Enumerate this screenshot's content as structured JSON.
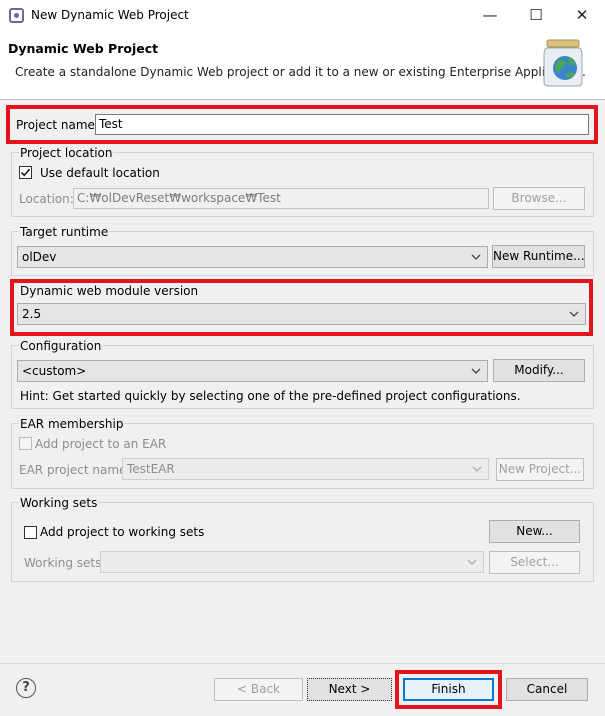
{
  "window": {
    "title": "New Dynamic Web Project",
    "minimize": "—",
    "maximize": "☐",
    "close": "✕"
  },
  "header": {
    "title": "Dynamic Web Project",
    "description": "Create a standalone Dynamic Web project or add it to a new or existing Enterprise Application."
  },
  "project_name": {
    "label": "Project name:",
    "value": "Test"
  },
  "project_location": {
    "group_label": "Project location",
    "use_default_label": "Use default location",
    "use_default_checked": true,
    "location_label": "Location:",
    "location_value": "C:₩olDevReset₩workspace₩Test",
    "browse_label": "Browse..."
  },
  "target_runtime": {
    "group_label": "Target runtime",
    "value": "olDev",
    "new_runtime_label": "New Runtime..."
  },
  "module_version": {
    "label": "Dynamic web module version",
    "value": "2.5"
  },
  "configuration": {
    "label": "Configuration",
    "value": "<custom>",
    "modify_label": "Modify...",
    "hint": "Hint: Get started quickly by selecting one of the pre-defined project configurations."
  },
  "ear_membership": {
    "group_label": "EAR membership",
    "add_label": "Add project to an EAR",
    "ear_name_label": "EAR project name:",
    "ear_name_value": "TestEAR",
    "new_project_label": "New Project..."
  },
  "working_sets": {
    "group_label": "Working sets",
    "add_label": "Add project to working sets",
    "new_label": "New...",
    "sets_label": "Working sets:",
    "sets_value": "",
    "select_label": "Select..."
  },
  "footer": {
    "help": "?",
    "back_label": "< Back",
    "next_label": "Next >",
    "finish_label": "Finish",
    "cancel_label": "Cancel"
  },
  "colors": {
    "highlight": "#e4141e",
    "focus": "#0078d7"
  }
}
